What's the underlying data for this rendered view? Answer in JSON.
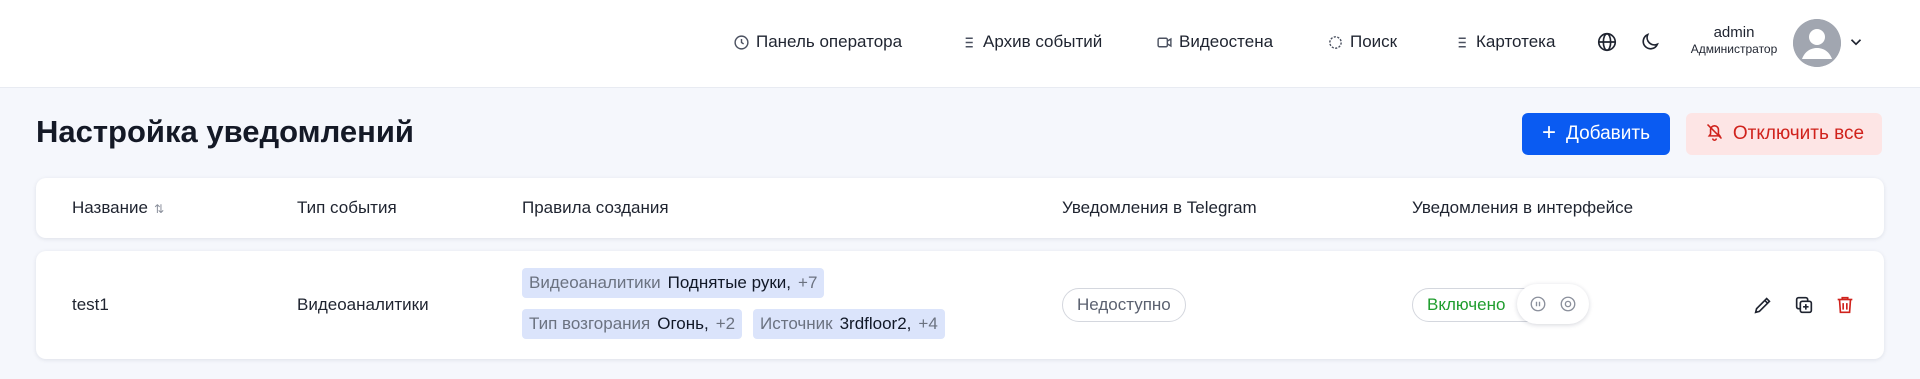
{
  "nav": {
    "items": [
      {
        "label": "Панель оператора",
        "icon": "clock-icon"
      },
      {
        "label": "Архив событий",
        "icon": "list-icon"
      },
      {
        "label": "Видеостена",
        "icon": "video-camera-icon"
      },
      {
        "label": "Поиск",
        "icon": "crosshair-icon"
      },
      {
        "label": "Картотека",
        "icon": "list-icon"
      }
    ],
    "language_icon": "globe-icon",
    "theme_icon": "moon-icon"
  },
  "user": {
    "name": "admin",
    "role": "Администратор"
  },
  "page": {
    "title": "Настройка уведомлений",
    "add_button": "Добавить",
    "disable_all_button": "Отключить все"
  },
  "table": {
    "columns": [
      "Название",
      "Тип события",
      "Правила создания",
      "Уведомления в Telegram",
      "Уведомления в интерфейсе"
    ],
    "rows": [
      {
        "name": "test1",
        "event_type": "Видеоаналитики",
        "rules": [
          {
            "key": "Видеоаналитики",
            "value": "Поднятые руки,",
            "more": "+7"
          },
          {
            "key": "Тип возгорания",
            "value": "Огонь,",
            "more": "+2"
          },
          {
            "key": "Источник",
            "value": "3rdfloor2,",
            "more": "+4"
          }
        ],
        "telegram": "Недоступно",
        "interface": "Включено"
      }
    ]
  },
  "colors": {
    "primary": "#0a5bf2",
    "danger": "#d0221c",
    "danger_bg": "#fde5e5",
    "success": "#1f9d2e",
    "chip_bg": "#dbe4fb"
  }
}
